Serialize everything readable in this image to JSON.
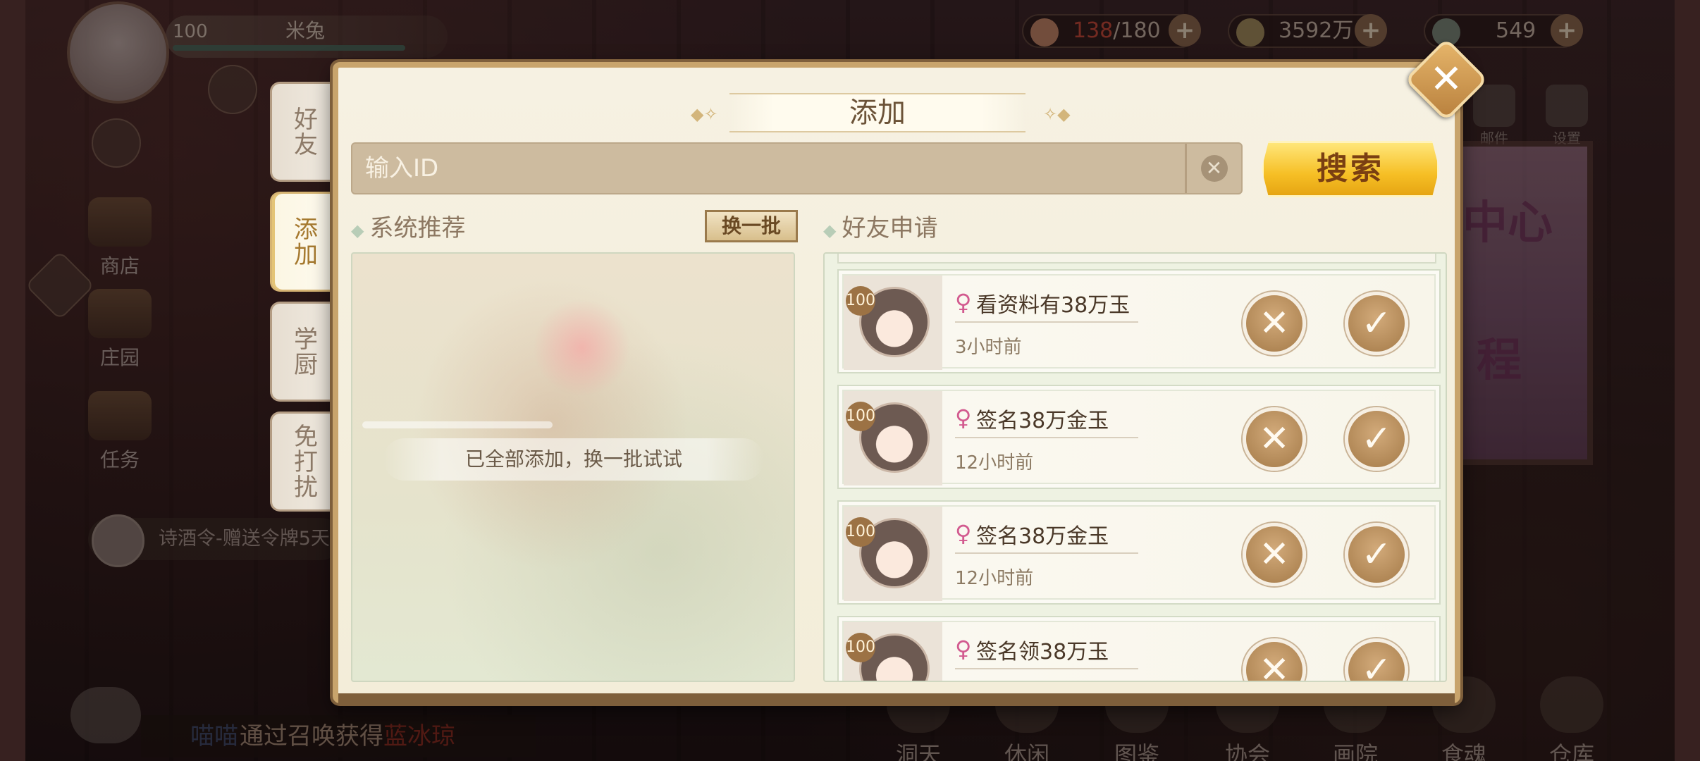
{
  "background": {
    "player": {
      "level": "100",
      "name": "米兔"
    },
    "resources": [
      {
        "icon": "stamina-bowl-icon",
        "value_current": "138",
        "value_max": "/180",
        "color": "#c94a3a"
      },
      {
        "icon": "coin-icon",
        "value": "3592万"
      },
      {
        "icon": "jade-icon",
        "value": "549"
      }
    ],
    "left_menu": [
      "商店",
      "庄园",
      "任务"
    ],
    "chat_preview": "诗酒令-赠送令牌5天",
    "notice": {
      "prefix": "喵喵",
      "text": "通过召唤获得",
      "highlight": "蓝冰琼"
    },
    "bottom_nav": [
      "洞天",
      "休闲",
      "图鉴",
      "协会",
      "画院",
      "食魂",
      "仓库"
    ],
    "top_right_icons": [
      "邮件",
      "设置"
    ],
    "event_text": [
      "中心",
      "程"
    ]
  },
  "tabs": [
    {
      "label": "好友",
      "active": false
    },
    {
      "label": "添加",
      "active": true
    },
    {
      "label": "学厨",
      "active": false
    },
    {
      "label": "免打扰",
      "active": false
    }
  ],
  "dialog": {
    "title": "添加",
    "search": {
      "placeholder": "输入ID",
      "value": "",
      "button_label": "搜索"
    },
    "recommend": {
      "label": "系统推荐",
      "swap_label": "换一批",
      "empty_message": "已全部添加，换一批试试"
    },
    "requests": {
      "label": "好友申请",
      "items": [
        {
          "level": "100",
          "name": "看资料有38万玉",
          "time": "3小时前"
        },
        {
          "level": "100",
          "name": "签名38万金玉",
          "time": "12小时前"
        },
        {
          "level": "100",
          "name": "签名38万金玉",
          "time": "12小时前"
        },
        {
          "level": "100",
          "name": "签名领38万玉",
          "time": ""
        }
      ]
    }
  },
  "colors": {
    "accent_gold": "#f6bf25",
    "panel_bg": "#f6f1e2",
    "gender_female": "#d25a8f"
  }
}
